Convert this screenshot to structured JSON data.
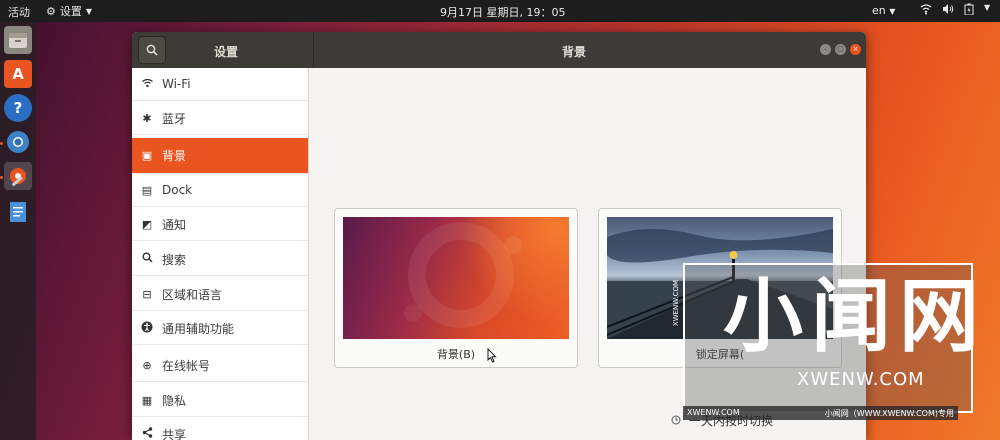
{
  "topbar": {
    "activities": "活动",
    "app_name": "设置",
    "clock": "9月17日 星期日, 19：05",
    "language": "en"
  },
  "window": {
    "left_title": "设置",
    "title": "背景"
  },
  "sidebar": {
    "items": [
      {
        "label": "Wi-Fi",
        "icon": "wifi-icon"
      },
      {
        "label": "蓝牙",
        "icon": "bluetooth-icon"
      },
      {
        "label": "背景",
        "icon": "background-icon"
      },
      {
        "label": "Dock",
        "icon": "dock-icon"
      },
      {
        "label": "通知",
        "icon": "notification-icon"
      },
      {
        "label": "搜索",
        "icon": "search-icon"
      },
      {
        "label": "区域和语言",
        "icon": "region-icon"
      },
      {
        "label": "通用辅助功能",
        "icon": "accessibility-icon"
      },
      {
        "label": "在线帐号",
        "icon": "online-accounts-icon"
      },
      {
        "label": "隐私",
        "icon": "privacy-icon"
      },
      {
        "label": "共享",
        "icon": "share-icon"
      }
    ],
    "selected": "背景"
  },
  "content": {
    "background_label": "背景(B)",
    "lockscreen_label": "锁定屏幕(",
    "schedule_text": "一天内按时切换"
  },
  "watermark": {
    "big_text": "小闻网",
    "url": "XWENW.COM",
    "vertical_text": "XWENW.COM",
    "bar_left": "XWENW.COM",
    "bar_right": "小闻网（WWW.XWENW.COM)专用"
  },
  "colors": {
    "accent": "#e95420",
    "titlebar": "#3c3b37",
    "topbar": "#1d1d1d"
  }
}
